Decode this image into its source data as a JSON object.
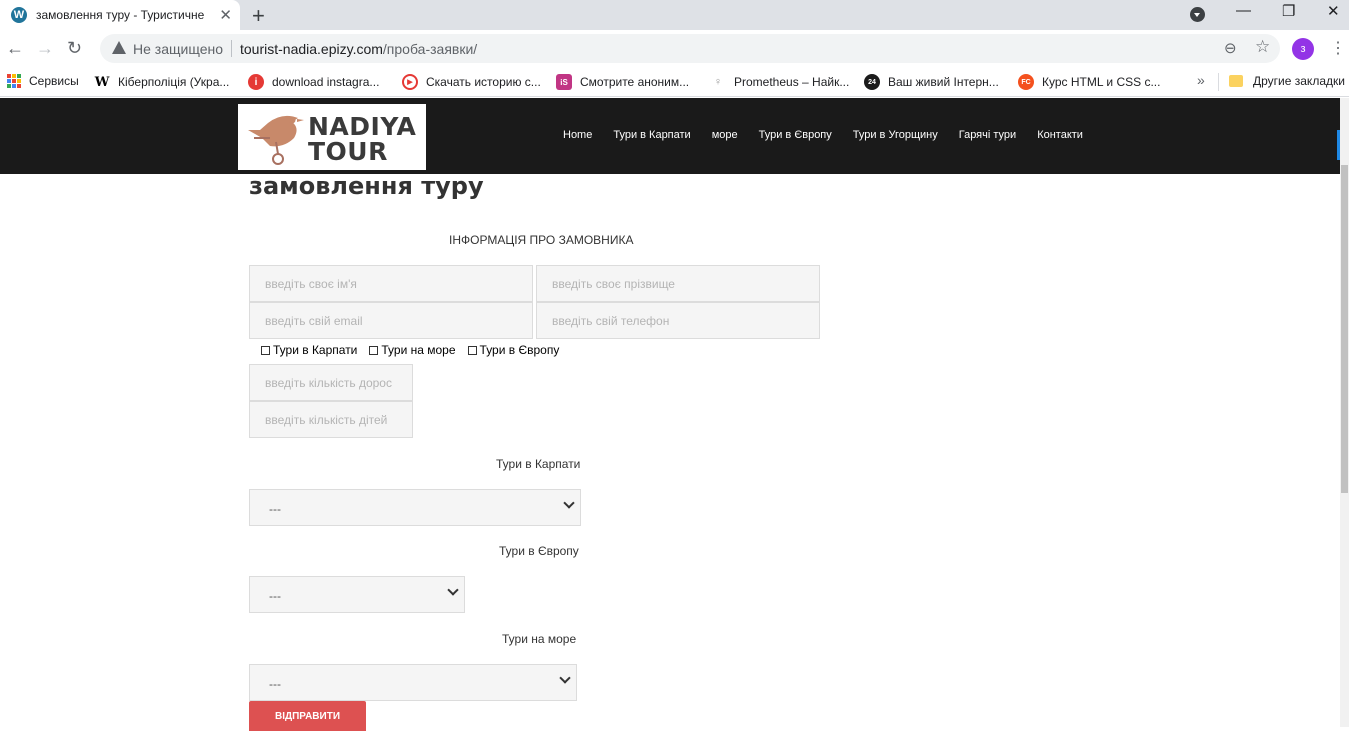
{
  "browser": {
    "tab_title": "замовлення туру - Туристичне агентство",
    "tab_favicon": "W",
    "new_tab": "+",
    "controls": {
      "minimize": "—",
      "restore": "❐",
      "close": "✕"
    },
    "security": "Не защищено",
    "url_host": "tourist-nadia.epizy.com",
    "url_path": "/проба-заявки/",
    "profile_initial": "з",
    "bookmarks": [
      {
        "label": "Сервисы",
        "icon": "apps-grid-icon"
      },
      {
        "label": "Кіберполіція (Укра...",
        "icon": "wikipedia-icon",
        "glyph": "W",
        "color": "#000000"
      },
      {
        "label": "download instagra...",
        "icon": "info-red-icon",
        "glyph": "i",
        "color": "#e53935"
      },
      {
        "label": "Скачать историю с...",
        "icon": "play-circle-icon",
        "glyph": "▶",
        "color": "#e53935"
      },
      {
        "label": "Смотрите аноним...",
        "icon": "instagram-story-icon",
        "glyph": "iS",
        "color": "#c13584"
      },
      {
        "label": "Prometheus – Найк...",
        "icon": "bulb-icon",
        "glyph": "💡",
        "color": "#ffffff"
      },
      {
        "label": "Ваш живий Інтерн...",
        "icon": "news24-icon",
        "glyph": "24",
        "color": "#1b1b1b"
      },
      {
        "label": "Курс HTML и CSS с...",
        "icon": "fc-icon",
        "glyph": "FC",
        "color": "#f4511e"
      }
    ],
    "bookmarks_overflow": "»",
    "other_bookmarks": "Другие закладки"
  },
  "site": {
    "logo_line1": "NADIYA",
    "logo_line2": "TOUR",
    "nav": [
      "Home",
      "Тури в Карпати",
      "море",
      "Тури в Європу",
      "Тури в Угорщину",
      "Гарячі тури",
      "Контакти"
    ]
  },
  "form": {
    "page_title": "замовлення туру",
    "section_title": "ІНФОРМАЦІЯ ПРО ЗАМОВНИКА",
    "first_name_placeholder": "введіть своє ім'я",
    "last_name_placeholder": "введіть своє прізвище",
    "email_placeholder": "введіть свій email",
    "phone_placeholder": "введіть свій телефон",
    "tour_types": [
      "Тури в Карпати",
      "Тури на море",
      "Тури в Європу"
    ],
    "adults_placeholder": "введіть кількість дорос",
    "children_placeholder": "введіть кількість дітей",
    "carpathians_label": "Тури в Карпати",
    "carpathians_value": "---",
    "europe_label": "Тури в Європу",
    "europe_value": "---",
    "sea_label": "Тури на море",
    "sea_value": "---",
    "submit_label": "ВІДПРАВИТИ"
  },
  "colors": {
    "header_bg": "#1a1a1a",
    "submit_bg": "#dd5151",
    "logo_bird": "#c8896a"
  }
}
